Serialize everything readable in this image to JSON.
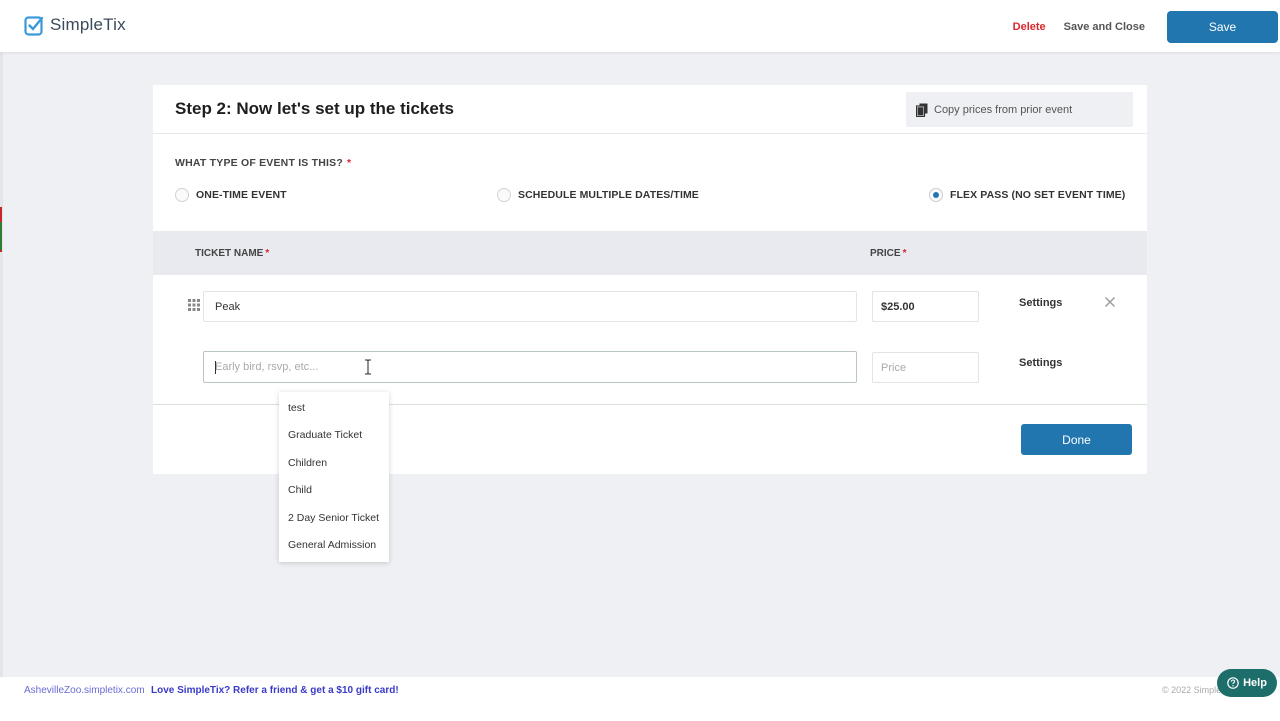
{
  "app": {
    "name": "SimpleTix"
  },
  "toolbar": {
    "delete_label": "Delete",
    "save_close_label": "Save and Close",
    "save_label": "Save"
  },
  "step": {
    "title": "Step 2: Now let's set up the tickets",
    "copy_label": "Copy prices from prior event"
  },
  "event_type": {
    "question": "WHAT TYPE OF EVENT IS THIS?",
    "required_mark": "*",
    "options": [
      {
        "label": "ONE-TIME EVENT",
        "selected": false
      },
      {
        "label": "SCHEDULE MULTIPLE DATES/TIME",
        "selected": false
      },
      {
        "label": "FLEX PASS (NO SET EVENT TIME)",
        "selected": true
      }
    ]
  },
  "tickets": {
    "header": {
      "name": "TICKET NAME",
      "price": "PRICE",
      "required_mark": "*"
    },
    "rows": [
      {
        "name": "Peak",
        "price": "$25.00",
        "settings": "Settings"
      }
    ],
    "new_row": {
      "name_placeholder": "Early bird, rsvp, etc...",
      "price_placeholder": "Price",
      "settings": "Settings"
    },
    "done_label": "Done"
  },
  "suggestions": [
    "test",
    "Graduate Ticket",
    "Children",
    "Child",
    "2 Day Senior Ticket",
    "General Admission"
  ],
  "footer": {
    "domain": "AshevilleZoo.simpletix.com",
    "promo": "Love SimpleTix? Refer a friend & get a $10 gift card!",
    "copyright": "© 2022 SimpleTix"
  },
  "help": {
    "label": "Help"
  },
  "colors": {
    "primary": "#2276b0",
    "danger": "#d9272e",
    "help": "#1d6e6a"
  }
}
